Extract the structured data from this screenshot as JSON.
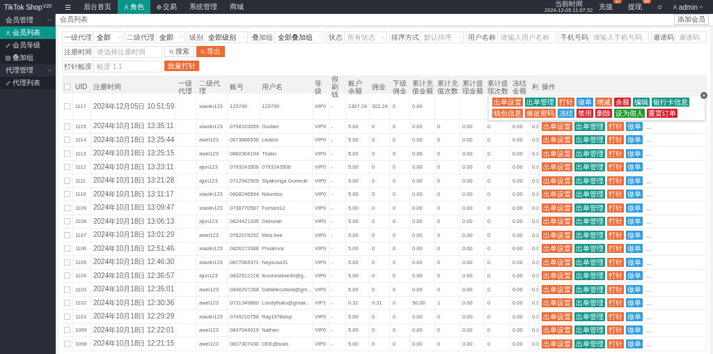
{
  "brand": {
    "name": "TikTok Shop",
    "version": "V20"
  },
  "top_nav": [
    {
      "label": "☰",
      "kind": "icon",
      "selected": false
    },
    {
      "label": "后台首页",
      "kind": "text",
      "selected": false
    },
    {
      "label": "角色",
      "kind": "user",
      "selected": true
    },
    {
      "label": "交易",
      "kind": "globe",
      "selected": false
    },
    {
      "label": "系统管理",
      "kind": "text",
      "selected": false
    },
    {
      "label": "商城",
      "kind": "text",
      "selected": false
    }
  ],
  "clock": {
    "label": "当前时间",
    "value": "2024-12-05 11:07:32"
  },
  "alerts": [
    {
      "label": "充值",
      "count": "17"
    },
    {
      "label": "提现",
      "count": "95"
    }
  ],
  "user": {
    "name": "admin"
  },
  "sidebar": [
    {
      "label": "会员管理",
      "expanded": true,
      "children": [
        {
          "label": "会员列表",
          "kind": "user",
          "selected": true
        },
        {
          "label": "会员等级",
          "kind": "link",
          "selected": false
        },
        {
          "label": "叠加组",
          "kind": "grid",
          "selected": false
        }
      ]
    },
    {
      "label": "代理管理",
      "expanded": true,
      "children": [
        {
          "label": "代理列表",
          "kind": "link",
          "selected": false
        }
      ]
    }
  ],
  "breadcrumb": "会员列表",
  "add_button": "添加会员",
  "filters": [
    {
      "label": "一级代理",
      "kind": "select",
      "value": "全部"
    },
    {
      "label": "二级代理",
      "kind": "select",
      "value": "全部"
    },
    {
      "label": "级别",
      "kind": "select",
      "value": "全部级别"
    },
    {
      "label": "叠加组",
      "kind": "select",
      "value": "全部叠加组"
    },
    {
      "label": "状态",
      "kind": "select",
      "placeholder": "所有状态"
    },
    {
      "label": "排序方式",
      "kind": "select",
      "placeholder": "默认排序"
    },
    {
      "label": "用户名称",
      "kind": "input",
      "placeholder": "请输入用户名称"
    },
    {
      "label": "手机号码",
      "kind": "input",
      "placeholder": "请输入手机号码"
    },
    {
      "label": "邀请码",
      "kind": "input",
      "placeholder": "邀请码"
    }
  ],
  "date_filter": {
    "label": "注册时间",
    "placeholder": "请选择注册时间"
  },
  "search_button": "搜索",
  "export_button": "导出",
  "dose_filter": {
    "label": "打针幅度",
    "placeholder": "幅度 1.1"
  },
  "batch_button": "批量打针",
  "table": {
    "select_all": {
      "checked": false
    },
    "columns": [
      "UID",
      "注册时间",
      "一级代理",
      "二级代理",
      "账号",
      "用户名",
      "等级",
      "假刷钱",
      "账户余额",
      "佣金",
      "下级佣金",
      "累计充值金额",
      "累计充值次数",
      "累计提现金额",
      "累计提现次数",
      "冻结金额",
      "利",
      "操作"
    ],
    "rows": [
      {
        "checked": false,
        "cells": [
          "1117",
          "2024年12月05日 10:51:59",
          "",
          "xiaolin123",
          "123799",
          "123799",
          "VIP0",
          "-",
          "1307.24",
          "302.24",
          "0",
          "0.00"
        ],
        "actions": []
      },
      {
        "checked": false,
        "cells": [
          "1115",
          "2024年10月18日 13:35:11",
          "",
          "xiaolin123",
          "0798103059",
          "Gudani",
          "VIP0",
          "-",
          "5.00",
          "0",
          "0",
          "0.00",
          "0",
          "0.00",
          "0",
          "0.00",
          "0.0"
        ],
        "actions": [
          {
            "label": "出单设置",
            "color": "#ec6a35"
          },
          {
            "label": "出单管理",
            "color": "#17978a"
          },
          {
            "label": "打针",
            "color": "#ec6a35"
          },
          {
            "label": "做单",
            "color": "#2d9de0"
          },
          {
            "label": "...",
            "color": "#ffffff"
          }
        ]
      },
      {
        "checked": false,
        "cells": [
          "1114",
          "2024年10月18日 13:25:44",
          "",
          "awei123",
          "0673886536",
          "Lisatov",
          "VIP0",
          "-",
          "5.00",
          "0",
          "0",
          "0.00",
          "0",
          "0.00",
          "0",
          "0.00",
          "0.0"
        ],
        "actions": [
          {
            "label": "出单设置",
            "color": "#ec6a35"
          },
          {
            "label": "出单管理",
            "color": "#17978a"
          },
          {
            "label": "打针",
            "color": "#ec6a35"
          },
          {
            "label": "做单",
            "color": "#2d9de0"
          },
          {
            "label": "...",
            "color": "#ffffff"
          }
        ]
      },
      {
        "checked": false,
        "cells": [
          "1113",
          "2024年10月18日 13:25:15",
          "",
          "awei123",
          "0660304194",
          "Thabo",
          "VIP0",
          "-",
          "5.00",
          "0",
          "0",
          "0.00",
          "0",
          "0.00",
          "0",
          "0.00",
          "0.0"
        ],
        "actions": [
          {
            "label": "出单设置",
            "color": "#ec6a35"
          },
          {
            "label": "出单管理",
            "color": "#17978a"
          },
          {
            "label": "打针",
            "color": "#ec6a35"
          },
          {
            "label": "做单",
            "color": "#2d9de0"
          },
          {
            "label": "...",
            "color": "#ffffff"
          }
        ]
      },
      {
        "checked": false,
        "cells": [
          "1112",
          "2024年10月18日 13:23:11",
          "",
          "ajun123",
          "0793143506",
          "0793143506",
          "VIP0",
          "-",
          "5.00",
          "0",
          "0",
          "0.00",
          "0",
          "0.00",
          "0",
          "0.00",
          "0.0"
        ],
        "actions": [
          {
            "label": "出单设置",
            "color": "#ec6a35"
          },
          {
            "label": "出单管理",
            "color": "#17978a"
          },
          {
            "label": "打针",
            "color": "#ec6a35"
          },
          {
            "label": "做单",
            "color": "#2d9de0"
          },
          {
            "label": "...",
            "color": "#ffffff"
          }
        ]
      },
      {
        "checked": false,
        "cells": [
          "1111",
          "2024年10月18日 13:21:28",
          "",
          "ajun123",
          "0712942905",
          "Siyabonga Gumede",
          "VIP0",
          "-",
          "5.00",
          "0",
          "0",
          "0.00",
          "0",
          "0.00",
          "0",
          "0.00",
          "0.0"
        ],
        "actions": [
          {
            "label": "出单设置",
            "color": "#ec6a35"
          },
          {
            "label": "出单管理",
            "color": "#17978a"
          },
          {
            "label": "打针",
            "color": "#ec6a35"
          },
          {
            "label": "做单",
            "color": "#2d9de0"
          },
          {
            "label": "...",
            "color": "#ffffff"
          }
        ]
      },
      {
        "checked": false,
        "cells": [
          "1110",
          "2024年10月18日 13:11:17",
          "",
          "xiaolin123",
          "0608246594",
          "Ndumiso",
          "VIP0",
          "-",
          "5.00",
          "0",
          "0",
          "0.00",
          "0",
          "0.00",
          "0",
          "0.00",
          "0.0"
        ],
        "actions": [
          {
            "label": "出单设置",
            "color": "#ec6a35"
          },
          {
            "label": "出单管理",
            "color": "#17978a"
          },
          {
            "label": "打针",
            "color": "#ec6a35"
          },
          {
            "label": "做单",
            "color": "#2d9de0"
          },
          {
            "label": "...",
            "color": "#ffffff"
          }
        ]
      },
      {
        "checked": false,
        "cells": [
          "1109",
          "2024年10月18日 13:09:47",
          "",
          "xiaolin123",
          "0738770587",
          "Fumani12",
          "VIP0",
          "-",
          "5.00",
          "0",
          "0",
          "0.00",
          "0",
          "0.00",
          "0",
          "0.00",
          "0.0"
        ],
        "actions": [
          {
            "label": "出单设置",
            "color": "#ec6a35"
          },
          {
            "label": "出单管理",
            "color": "#17978a"
          },
          {
            "label": "打针",
            "color": "#ec6a35"
          },
          {
            "label": "做单",
            "color": "#2d9de0"
          },
          {
            "label": "...",
            "color": "#ffffff"
          }
        ]
      },
      {
        "checked": false,
        "cells": [
          "1108",
          "2024年10月18日 13:06:13",
          "",
          "ajun123",
          "0624421335",
          "Deborah",
          "VIP0",
          "-",
          "5.00",
          "0",
          "0",
          "0.00",
          "0",
          "0.00",
          "0",
          "0.00",
          "0.0"
        ],
        "actions": [
          {
            "label": "出单设置",
            "color": "#ec6a35"
          },
          {
            "label": "出单管理",
            "color": "#17978a"
          },
          {
            "label": "打针",
            "color": "#ec6a35"
          },
          {
            "label": "做单",
            "color": "#2d9de0"
          },
          {
            "label": "...",
            "color": "#ffffff"
          }
        ]
      },
      {
        "checked": false,
        "cells": [
          "1107",
          "2024年10月18日 13:01:29",
          "",
          "awei123",
          "0762078292",
          "Miss bee",
          "VIP0",
          "-",
          "5.00",
          "0",
          "0",
          "0.00",
          "0",
          "0.00",
          "0",
          "0.00",
          "0.0"
        ],
        "actions": [
          {
            "label": "出单设置",
            "color": "#ec6a35"
          },
          {
            "label": "出单管理",
            "color": "#17978a"
          },
          {
            "label": "打针",
            "color": "#ec6a35"
          },
          {
            "label": "做单",
            "color": "#2d9de0"
          },
          {
            "label": "...",
            "color": "#ffffff"
          }
        ]
      },
      {
        "checked": false,
        "cells": [
          "1106",
          "2024年10月18日 12:51:46",
          "",
          "xiaolin123",
          "0826173388",
          "Prudence",
          "VIP0",
          "-",
          "5.00",
          "0",
          "0",
          "0.00",
          "0",
          "0.00",
          "0",
          "0.00",
          "0.0"
        ],
        "actions": [
          {
            "label": "出单设置",
            "color": "#ec6a35"
          },
          {
            "label": "出单管理",
            "color": "#17978a"
          },
          {
            "label": "打针",
            "color": "#ec6a35"
          },
          {
            "label": "做单",
            "color": "#2d9de0"
          },
          {
            "label": "...",
            "color": "#ffffff"
          }
        ]
      },
      {
        "checked": false,
        "cells": [
          "1105",
          "2024年10月18日 12:46:30",
          "",
          "xiaolin123",
          "0677064371",
          "Neysosa31",
          "VIP0",
          "-",
          "5.00",
          "0",
          "0",
          "0.00",
          "0",
          "0.00",
          "0",
          "0.00",
          "0.0"
        ],
        "actions": [
          {
            "label": "出单设置",
            "color": "#ec6a35"
          },
          {
            "label": "出单管理",
            "color": "#17978a"
          },
          {
            "label": "打针",
            "color": "#ec6a35"
          },
          {
            "label": "做单",
            "color": "#2d9de0"
          },
          {
            "label": "...",
            "color": "#ffffff"
          }
        ]
      },
      {
        "checked": false,
        "cells": [
          "1104",
          "2024年10月18日 12:36:57",
          "",
          "ajun123",
          "0832512218",
          "tiroonesilwe40@g...",
          "VIP0",
          "-",
          "5.00",
          "0",
          "0",
          "0.00",
          "0",
          "0.00",
          "0",
          "0.00",
          "0.0"
        ],
        "actions": [
          {
            "label": "出单设置",
            "color": "#ec6a35"
          },
          {
            "label": "出单管理",
            "color": "#17978a"
          },
          {
            "label": "打针",
            "color": "#ec6a35"
          },
          {
            "label": "做单",
            "color": "#2d9de0"
          },
          {
            "label": "...",
            "color": "#ffffff"
          }
        ]
      },
      {
        "checked": false,
        "cells": [
          "1103",
          "2024年10月18日 12:35:01",
          "",
          "awei123",
          "0840297268",
          "Dafalilecobela@gm...",
          "VIP0",
          "-",
          "5.00",
          "0",
          "0",
          "0.00",
          "0",
          "0.00",
          "0",
          "0.00",
          "0.0"
        ],
        "actions": [
          {
            "label": "出单设置",
            "color": "#ec6a35"
          },
          {
            "label": "出单管理",
            "color": "#17978a"
          },
          {
            "label": "打针",
            "color": "#ec6a35"
          },
          {
            "label": "做单",
            "color": "#2d9de0"
          },
          {
            "label": "...",
            "color": "#ffffff"
          }
        ]
      },
      {
        "checked": false,
        "cells": [
          "1102",
          "2024年10月18日 12:30:36",
          "",
          "awei123",
          "0731349660",
          "Londythato@gmail...",
          "VIP1",
          "-",
          "0.31",
          "9.31",
          "0",
          "50.00",
          "1",
          "0.00",
          "0",
          "0.00",
          "0.0"
        ],
        "actions": [
          {
            "label": "出单设置",
            "color": "#ec6a35"
          },
          {
            "label": "出单管理",
            "color": "#17978a"
          },
          {
            "label": "打针",
            "color": "#ec6a35"
          },
          {
            "label": "做单",
            "color": "#2d9de0"
          },
          {
            "label": "...",
            "color": "#ffffff"
          }
        ]
      },
      {
        "checked": false,
        "cells": [
          "1101",
          "2024年10月18日 12:29:29",
          "",
          "xiaolin123",
          "0749210756",
          "Ray1978sisp",
          "VIP0",
          "-",
          "5.00",
          "0",
          "0",
          "0.00",
          "0",
          "0.00",
          "0",
          "0.00",
          "0.0"
        ],
        "actions": [
          {
            "label": "出单设置",
            "color": "#ec6a35"
          },
          {
            "label": "出单管理",
            "color": "#17978a"
          },
          {
            "label": "打针",
            "color": "#ec6a35"
          },
          {
            "label": "做单",
            "color": "#2d9de0"
          },
          {
            "label": "...",
            "color": "#ffffff"
          }
        ]
      },
      {
        "checked": false,
        "cells": [
          "1099",
          "2024年10月18日 12:22:01",
          "",
          "awei123",
          "0847044019",
          "Nathan",
          "VIP0",
          "-",
          "5.00",
          "0",
          "0",
          "0.00",
          "0",
          "0.00",
          "0",
          "0.00",
          "0.0"
        ],
        "actions": [
          {
            "label": "出单设置",
            "color": "#ec6a35"
          },
          {
            "label": "出单管理",
            "color": "#17978a"
          },
          {
            "label": "打针",
            "color": "#ec6a35"
          },
          {
            "label": "做单",
            "color": "#2d9de0"
          },
          {
            "label": "...",
            "color": "#ffffff"
          }
        ]
      },
      {
        "checked": false,
        "cells": [
          "1098",
          "2024年10月18日 12:21:15",
          "",
          "awei123",
          "0817307430",
          "DEE@soks",
          "VIP0",
          "-",
          "5.00",
          "0",
          "0",
          "0.00",
          "0",
          "0.00",
          "0",
          "0.00",
          "0.0"
        ],
        "actions": [
          {
            "label": "出单设置",
            "color": "#ec6a35"
          },
          {
            "label": "出单管理",
            "color": "#17978a"
          },
          {
            "label": "打针",
            "color": "#ec6a35"
          },
          {
            "label": "做单",
            "color": "#2d9de0"
          },
          {
            "label": "...",
            "color": "#ffffff"
          }
        ]
      }
    ]
  },
  "action_popover": {
    "items": [
      {
        "label": "出单设置",
        "color": "#ec6a35"
      },
      {
        "label": "出单管理",
        "color": "#17978a"
      },
      {
        "label": "打针",
        "color": "#ec6a35"
      },
      {
        "label": "做单",
        "color": "#2d9de0"
      },
      {
        "label": "增减",
        "color": "#ec6a35"
      },
      {
        "label": "余额",
        "color": "#d4202a"
      },
      {
        "label": "编辑",
        "color": "#17978a"
      },
      {
        "label": "银行卡信息",
        "color": "#17978a"
      },
      {
        "label": "钱包信息",
        "color": "#ec6a35"
      },
      {
        "label": "修改密码",
        "color": "#ec6a35"
      },
      {
        "label": "冻结",
        "color": "#2d9de0"
      },
      {
        "label": "禁用",
        "color": "#d4202a"
      },
      {
        "label": "删除",
        "color": "#d4202a"
      },
      {
        "label": "设为假人",
        "color": "#1e9a2e"
      },
      {
        "label": "重置订单",
        "color": "#d4202a"
      }
    ]
  }
}
